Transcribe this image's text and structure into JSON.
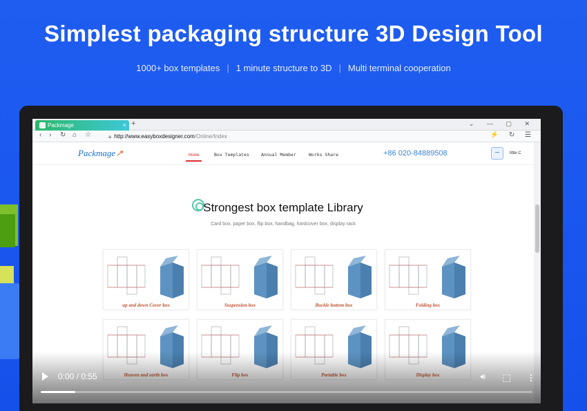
{
  "hero": {
    "title_regular": "Simplest packaging structure ",
    "title_bold": "3D Design Tool",
    "features": [
      "1000+ box templates",
      "1 minute structure to 3D",
      "Multi terminal cooperation"
    ],
    "separator": "|"
  },
  "browser": {
    "tab_title": "Packmage",
    "tab_close": "×",
    "new_tab": "+",
    "url_host": "http://www.easyboxdesigner.com",
    "url_path": "/Online/Index",
    "back_icon": "‹",
    "forward_icon": "›",
    "window_controls": "⌄ — ▢ ✕",
    "toolbar_icons": "⚡ ↻ ☰"
  },
  "site": {
    "logo_main": "Packmage",
    "logo_accent": "↗",
    "nav": [
      {
        "label": "Home",
        "active": true
      },
      {
        "label": "Box Templates"
      },
      {
        "label": "Annual Member"
      },
      {
        "label": "Works Share"
      }
    ],
    "phone": "+86 020-84889508",
    "username": "little C"
  },
  "section": {
    "title": "Strongest box template Library",
    "subtitle": "Card box, paper box, flip box, handbag, hardcover box, display rack"
  },
  "cards": [
    {
      "label": "up and down Cover box"
    },
    {
      "label": "Suspension box"
    },
    {
      "label": "Buckle bottom box"
    },
    {
      "label": "Folding box"
    },
    {
      "label": "Heaven and earth box"
    },
    {
      "label": "Flip box"
    },
    {
      "label": "Portable box"
    },
    {
      "label": "Display box"
    }
  ],
  "video": {
    "time": "0:00 / 0:55",
    "progress": 0.07
  },
  "colors": {
    "background": "#1a56ee",
    "accent_red": "#d33333",
    "box_blue": "#4a7fae",
    "label_orange": "#c0522f"
  }
}
